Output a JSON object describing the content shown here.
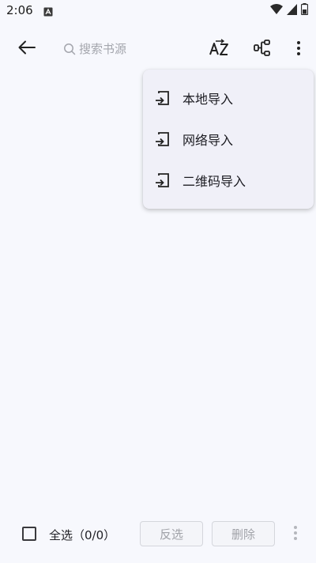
{
  "status_bar": {
    "time": "2:06",
    "icons": [
      "notification-a-icon",
      "wifi-icon",
      "signal-icon",
      "battery-icon"
    ]
  },
  "toolbar": {
    "back_icon": "arrow-left-icon",
    "search": {
      "placeholder": "搜索书源",
      "value": ""
    },
    "sort_icon": "sort-az-icon",
    "group_icon": "group-icon",
    "more_icon": "more-vertical-icon"
  },
  "menu": {
    "items": [
      {
        "label": "本地导入",
        "icon": "import-icon"
      },
      {
        "label": "网络导入",
        "icon": "import-icon"
      },
      {
        "label": "二维码导入",
        "icon": "import-icon"
      }
    ]
  },
  "bottom_bar": {
    "select_all_label": "全选（0/0）",
    "select_all_checked": false,
    "invert_label": "反选",
    "delete_label": "删除",
    "more_icon": "more-vertical-icon"
  },
  "colors": {
    "background": "#f7f8fd",
    "menu_background": "#f0f0f8",
    "disabled_text": "#a0a2a8",
    "placeholder": "#a4a6ad"
  }
}
